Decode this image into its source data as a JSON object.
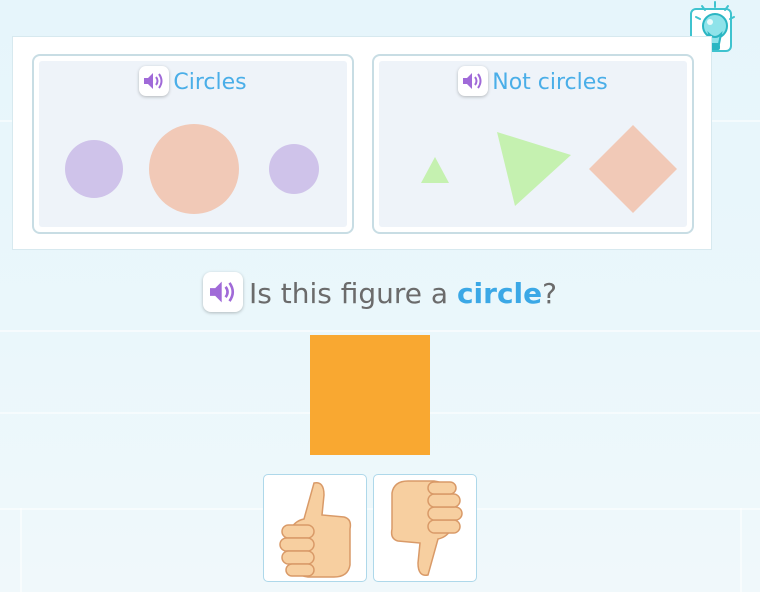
{
  "hint": {
    "icon": "lightbulb-icon"
  },
  "groups": [
    {
      "label": "Circles",
      "speaker_icon": "speaker-icon",
      "shapes": [
        "circle",
        "circle",
        "circle"
      ]
    },
    {
      "label": "Not circles",
      "speaker_icon": "speaker-icon",
      "shapes": [
        "triangle",
        "triangle",
        "square"
      ]
    }
  ],
  "question": {
    "prefix": "Is this figure a ",
    "keyword": "circle",
    "suffix": "?"
  },
  "figure": {
    "shape": "square",
    "color": "#f9a831"
  },
  "answers": [
    {
      "icon": "thumbs-up-icon",
      "meaning": "yes"
    },
    {
      "icon": "thumbs-down-icon",
      "meaning": "no"
    }
  ],
  "colors": {
    "heading": "#4aaee8",
    "keyword": "#3ba8e6",
    "circle_purple": "#cfc3ea",
    "circle_peach": "#f1c9b7",
    "triangle_green": "#c5f1b0",
    "diamond_peach": "#f1c9b7",
    "speaker_purple": "#a06ad8"
  }
}
